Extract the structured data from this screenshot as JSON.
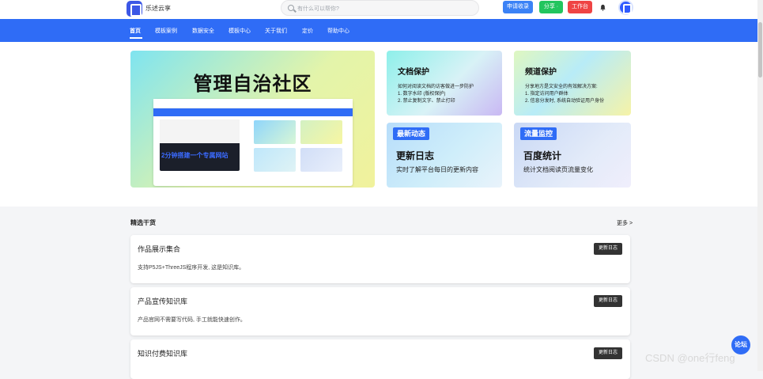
{
  "topbar": {
    "brand": "乐述云享",
    "search_placeholder": "有什么可以帮你?",
    "buttons": [
      "申请收录",
      "分享 ·",
      "工作台"
    ]
  },
  "nav": {
    "items": [
      "首页",
      "模板案例",
      "数据安全",
      "模板中心",
      "关于我们",
      "定价",
      "帮助中心"
    ]
  },
  "hero": {
    "title": "管理自治社区",
    "mock_slogan": "2分钟搭建一个专属网站"
  },
  "cards": [
    {
      "title": "文档保护",
      "desc": [
        "如何对阅读文档的访客做进一步防护",
        "1. 数字水印 (版权保护)",
        "2. 禁止复制文字、禁止打印"
      ]
    },
    {
      "title": "频道保护",
      "desc": [
        "分享地方是文安全的有效解决方案:",
        "1. 指定访问用户群体",
        "2. 信息分发时, 系统自动验证用户身份"
      ]
    },
    {
      "tag": "最新动态",
      "title": "更新日志",
      "desc": "实时了解平台每日的更新内容"
    },
    {
      "tag": "流量监控",
      "title": "百度统计",
      "desc": "统计文档阅读页流量变化"
    }
  ],
  "section": {
    "title": "精选干货",
    "more": "更多 >"
  },
  "rows": [
    {
      "title": "作品展示集合",
      "desc": "支持P5JS+ThreeJS程序开发, 这是知识库。",
      "button": "更新日志"
    },
    {
      "title": "产品宣传知识库",
      "desc": "产品官网不需要写代码, 手工就能快速创作。",
      "button": "更新日志"
    },
    {
      "title": "知识付费知识库",
      "desc": "",
      "button": "更新日志"
    }
  ],
  "fab": "论坛",
  "watermark": "CSDN @one行feng"
}
